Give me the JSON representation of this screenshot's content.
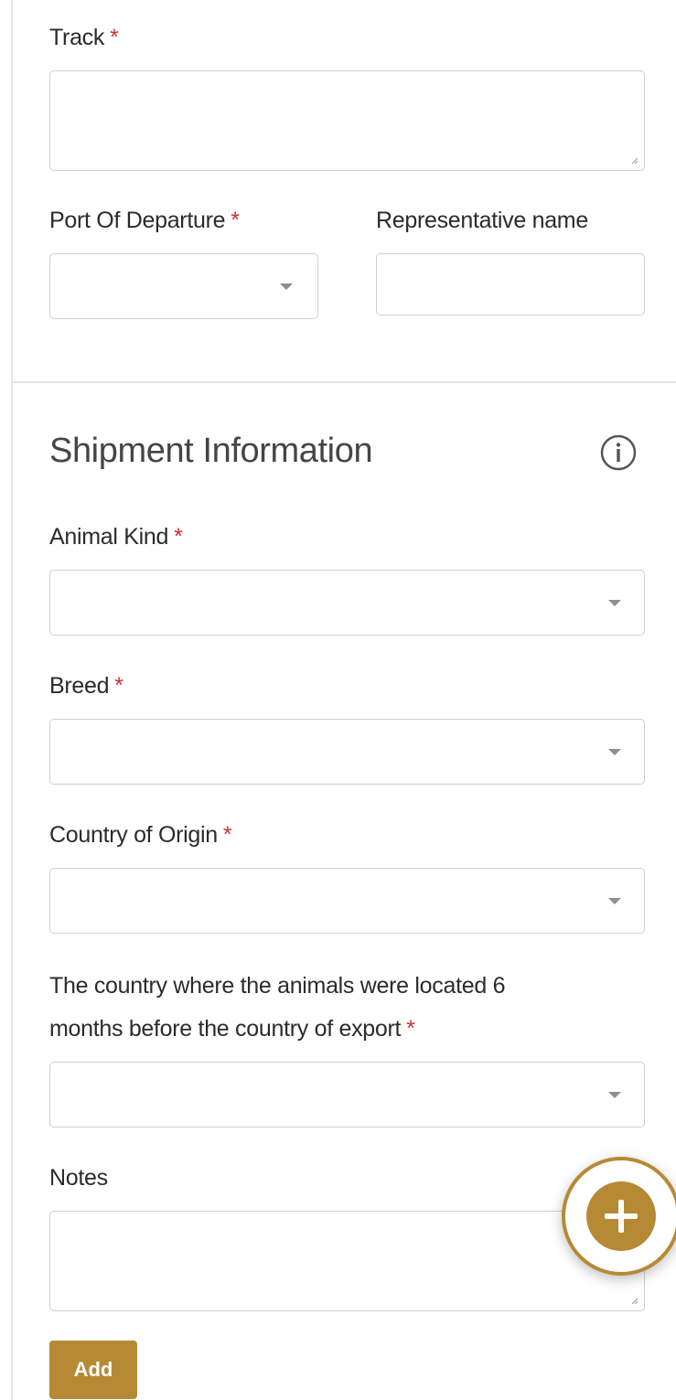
{
  "track": {
    "label": "Track",
    "required": "*",
    "value": ""
  },
  "port_of_departure": {
    "label": "Port Of Departure",
    "required": "*",
    "value": ""
  },
  "representative_name": {
    "label": "Representative name",
    "value": ""
  },
  "shipment_section": {
    "title": "Shipment Information",
    "info_icon": "info-circle-icon"
  },
  "animal_kind": {
    "label": "Animal Kind",
    "required": "*",
    "value": ""
  },
  "breed": {
    "label": "Breed",
    "required": "*",
    "value": ""
  },
  "country_of_origin": {
    "label": "Country of Origin",
    "required": "*",
    "value": ""
  },
  "previous_country": {
    "label_line1": "The country where the animals were located 6",
    "label_line2": "months before the country of export",
    "required": "*",
    "value": ""
  },
  "notes": {
    "label": "Notes",
    "value": ""
  },
  "fab": {
    "icon": "plus-icon"
  },
  "add_button": {
    "label": "Add"
  },
  "colors": {
    "accent": "#b68a35",
    "required": "#d32f2f",
    "border": "#d0d0d0"
  }
}
